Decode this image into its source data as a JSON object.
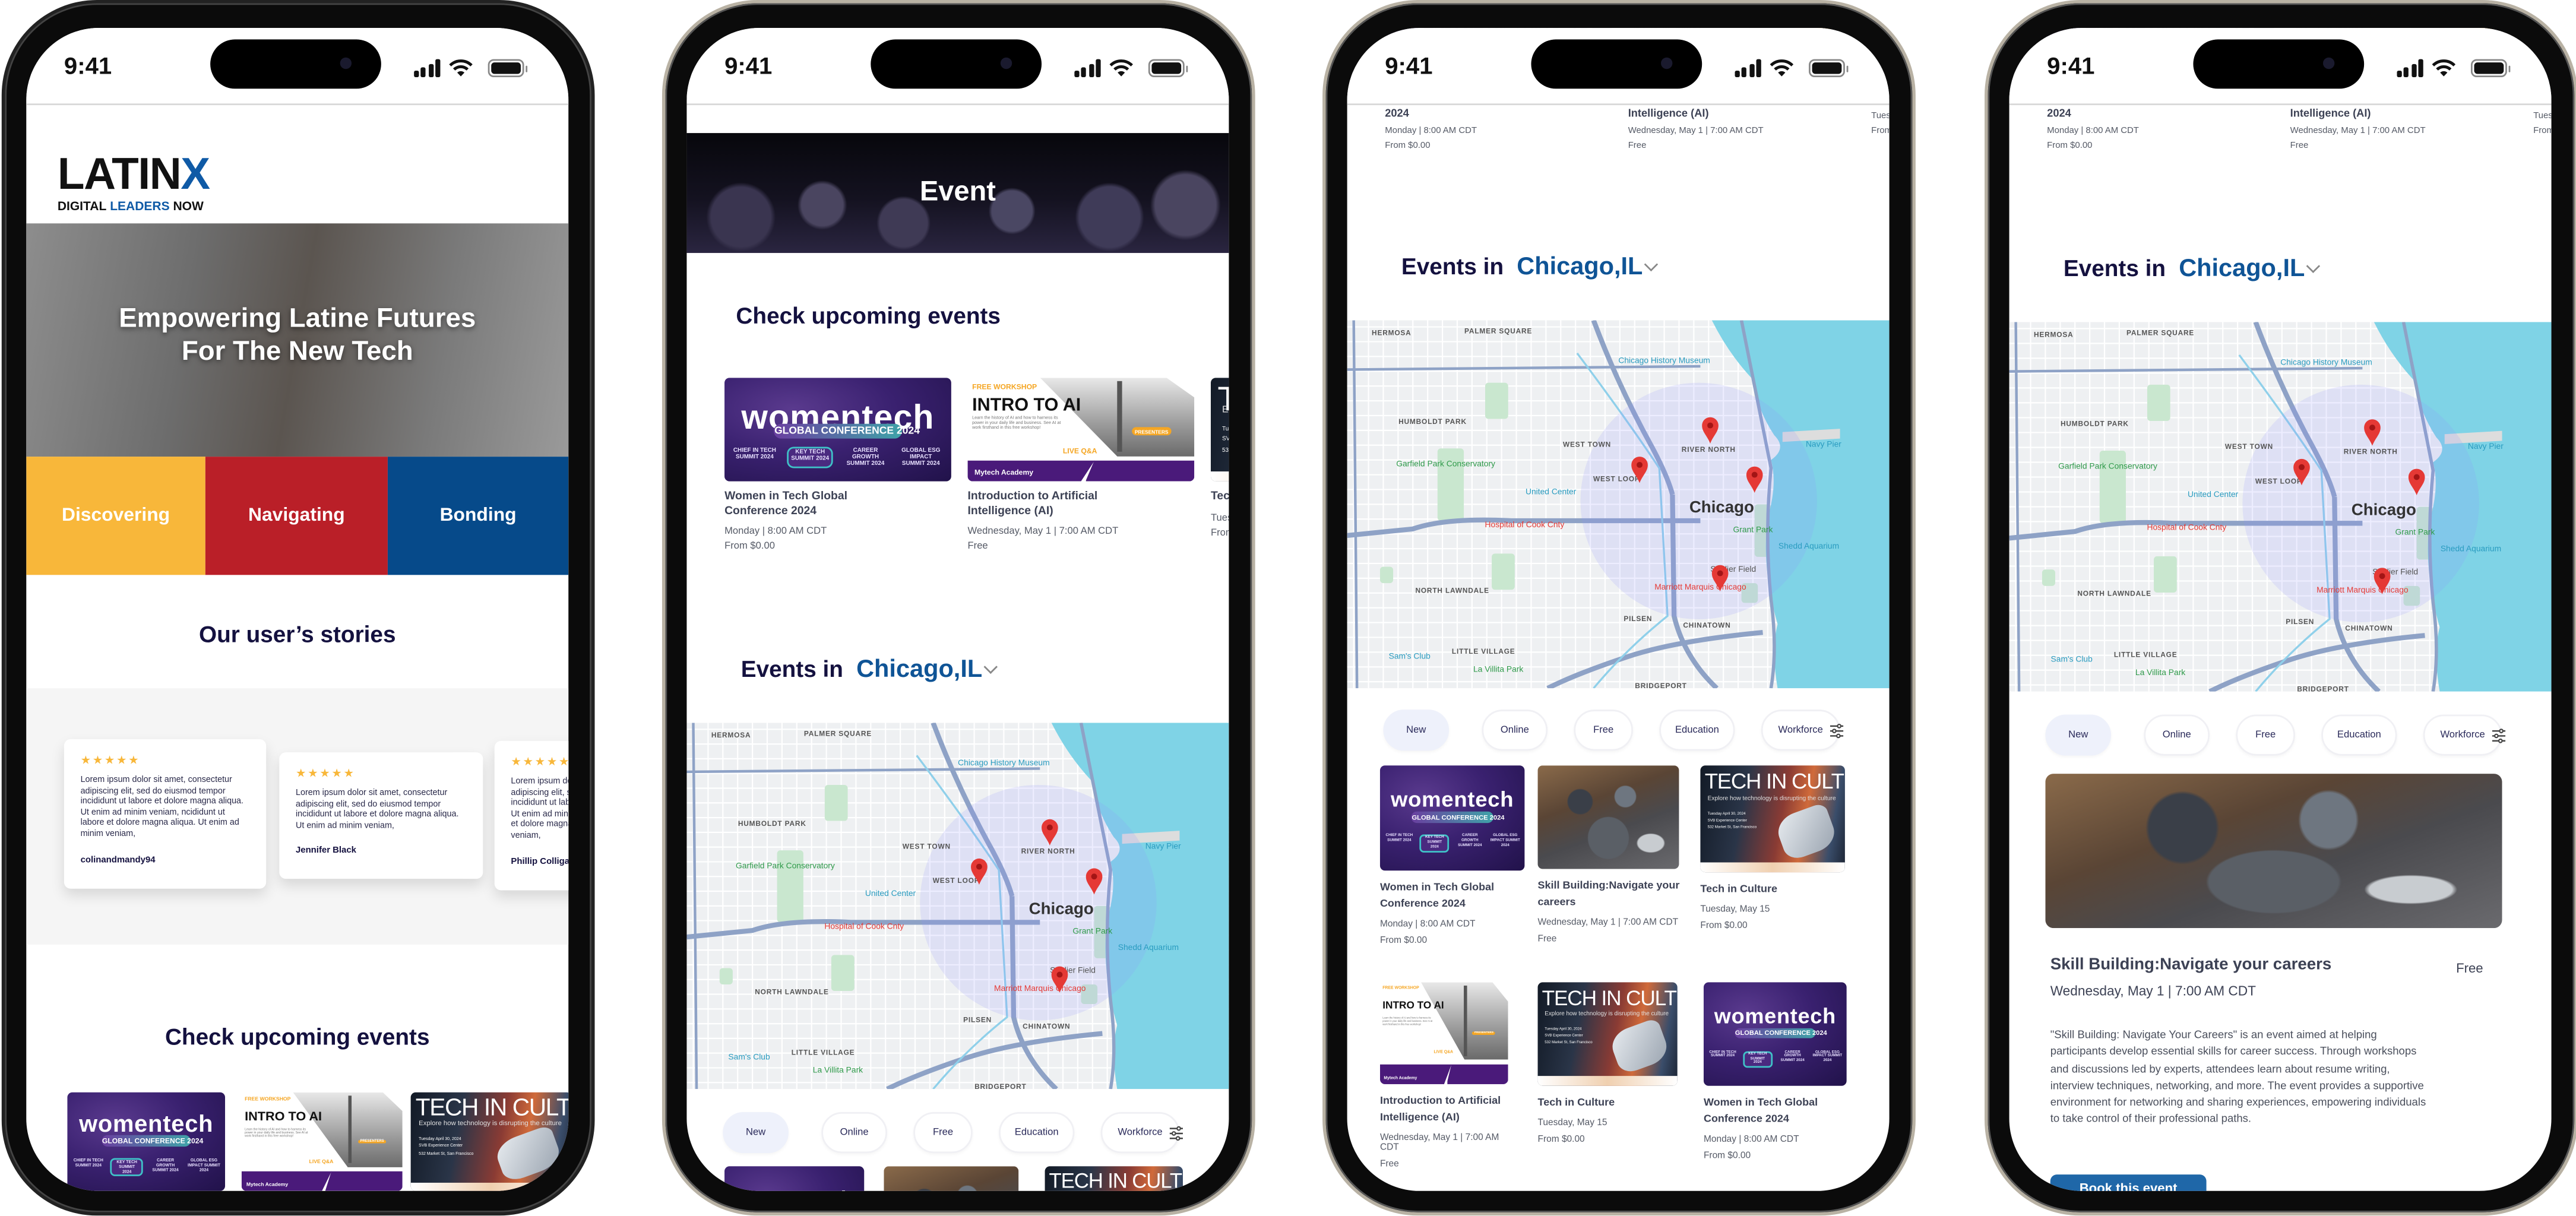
{
  "status": {
    "time": "9:41"
  },
  "colors": {
    "navy": "#14113f",
    "blue": "#0f5496",
    "yellow": "#f8b73a",
    "red": "#ba1f28",
    "darkblue": "#064a8a",
    "button": "#1f67a8"
  },
  "home": {
    "logo": {
      "main": "LATIN",
      "accent": "X",
      "sub_1": "DIGITAL",
      "sub_2": "LEADERS",
      "sub_3": "NOW"
    },
    "hero_title_1": "Empowering Latine Futures",
    "hero_title_2": "For The New Tech",
    "tiles": [
      {
        "label": "Discovering",
        "color": "#f8b73a"
      },
      {
        "label": "Navigating",
        "color": "#ba1f28"
      },
      {
        "label": "Bonding",
        "color": "#064a8a"
      }
    ],
    "stories_title": "Our user’s stories",
    "testimonials": [
      {
        "rating": 5,
        "stars": "★★★★★",
        "text": "Lorem ipsum dolor sit amet, consectetur adipiscing elit, sed do eiusmod tempor incididunt ut labore et dolore magna aliqua. Ut enim ad minim veniam, ncididunt ut labore et dolore magna aliqua. Ut enim ad minim veniam,",
        "author": "colinandmandy94"
      },
      {
        "rating": 5,
        "stars": "★★★★★",
        "text": "Lorem ipsum dolor sit amet, consectetur adipiscing elit, sed do eiusmod tempor incididunt ut labore et dolore magna aliqua. Ut enim ad minim veniam,",
        "author": "Jennifer Black"
      },
      {
        "rating": 5,
        "stars": "★★★★★",
        "text": "Lorem ipsum dolor sit amet, consectetur adipiscing elit, sed do eiusmod tempor incididunt ut labore et dolore magna aliqua. Ut enim ad minim veniam, ncididunt ut labore et dolore magna aliqua. Ut enim ad minim veniam,",
        "author": "Phillip Colliga"
      }
    ],
    "upcoming_title": "Check upcoming events"
  },
  "event_page": {
    "banner_title": "Event",
    "upcoming_title": "Check upcoming events",
    "events_in_label": "Events in",
    "city": "Chicago,IL"
  },
  "events": [
    {
      "title": "Women in Tech Global Conference 2024",
      "date": "Monday | 8:00 AM CDT",
      "price": "From $0.00",
      "poster": "womentech"
    },
    {
      "title": "Introduction to Artificial Intelligence (AI)",
      "date": "Wednesday, May 1 | 7:00 AM CDT",
      "price": "Free",
      "poster": "intro"
    },
    {
      "title": "Skill Building:Navigate your careers",
      "date": "Wednesday, May 1 | 7:00 AM CDT",
      "price": "Free",
      "poster": "photo"
    },
    {
      "title": "Tech in Culture",
      "date": "Tuesday, May 15",
      "price": "From $0.00",
      "poster": "culture"
    }
  ],
  "posters": {
    "womentech": {
      "title": "womentech",
      "pill": "GLOBAL CONFERENCE 2024",
      "sponsors": [
        "CHIEF IN TECH SUMMIT 2024",
        "KEY TECH SUMMIT 2024",
        "CAREER GROWTH SUMMIT 2024",
        "GLOBAL ESG IMPACT SUMMIT 2024"
      ]
    },
    "intro": {
      "tag": "FREE WORKSHOP",
      "title": "INTRO TO AI",
      "desc": "Learn the history of AI and how to harness its power in your daily life and business. See AI at work firsthand in this free workshop!",
      "live": "LIVE Q&A",
      "presenters": "PRESENTERS",
      "brand": "Mytech Academy"
    },
    "culture": {
      "title": "TECH IN CULTURE",
      "subtitle": "Explore how technology is disrupting the culture",
      "details": [
        "Tuesday April 30, 2024",
        "SVB Experience Center",
        "532 Market St, San Francisco"
      ]
    }
  },
  "filters": {
    "chips": [
      {
        "label": "New",
        "active": true
      },
      {
        "label": "Online",
        "active": false
      },
      {
        "label": "Free",
        "active": false
      },
      {
        "label": "Education",
        "active": false
      },
      {
        "label": "Workforce",
        "active": false
      }
    ],
    "filter_icon": "sliders-icon"
  },
  "map": {
    "city_label": "Chicago",
    "labels": [
      "RIVER NORTH",
      "WEST LOOP",
      "WEST TOWN",
      "Navy Pier",
      "Grant Park",
      "Shedd Aquarium",
      "Soldier Field",
      "CHINATOWN",
      "PILSEN",
      "HUMBOLDT PARK",
      "LITTLE VILLAGE",
      "NORTH LAWNDALE",
      "BRIDGEPORT",
      "United Center",
      "Chicago History Museum",
      "HERMOSA",
      "PALMER SQUARE",
      "Garfield Park Conservatory",
      "La Villita Park",
      "Sam's Club",
      "Marriott Marquis Chicago",
      "Hospital of Cook Cnty"
    ],
    "pin_count": 4,
    "colors": {
      "land": "#eef0f2",
      "water": "#7fd3e6",
      "park": "#c9e7cf",
      "highway": "#8ea2c6",
      "pin": "#e53935",
      "radius": "#8c8cff"
    }
  },
  "detail": {
    "title": "Skill Building:Navigate your careers",
    "price": "Free",
    "date": "Wednesday, May 1 | 7:00 AM CDT",
    "description": "\"Skill Building: Navigate Your Careers\" is an event aimed at helping participants develop essential skills for career success. Through workshops and discussions led by experts, attendees learn about resume writing, interview techniques, networking, and more. The event provides a supportive environment for networking and sharing experiences, empowering individuals to take control of their professional paths.",
    "book_label": "Book this event"
  }
}
